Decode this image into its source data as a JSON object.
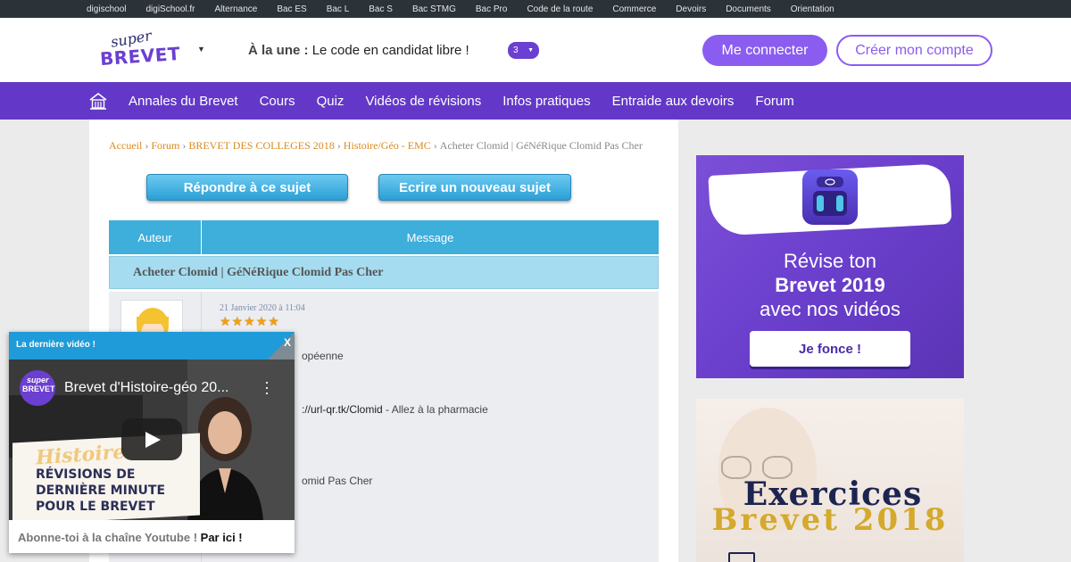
{
  "topbar": {
    "links": [
      "digischool",
      "digiSchool.fr",
      "Alternance",
      "Bac ES",
      "Bac L",
      "Bac S",
      "Bac STMG",
      "Bac Pro",
      "Code de la route",
      "Commerce",
      "Devoirs",
      "Documents",
      "Orientation"
    ]
  },
  "header": {
    "logo_top": "super",
    "logo_bottom": "BREVET",
    "une_label": "À la une :",
    "une_text": "Le code en candidat libre !",
    "une_count": "3",
    "login_label": "Me connecter",
    "signup_label": "Créer mon compte"
  },
  "nav": {
    "items": [
      "Annales du Brevet",
      "Cours",
      "Quiz",
      "Vidéos de révisions",
      "Infos pratiques",
      "Entraide aux devoirs",
      "Forum"
    ]
  },
  "breadcrumb": {
    "items": [
      "Accueil",
      "Forum",
      "BREVET DES COLLEGES 2018",
      "Histoire/Géo - EMC"
    ],
    "current": "Acheter Clomid | GéNéRique Clomid Pas Cher",
    "separator": "›"
  },
  "forum": {
    "reply_label": "Répondre à ce sujet",
    "new_topic_label": "Ecrire un nouveau sujet",
    "col_author": "Auteur",
    "col_message": "Message",
    "subject": "Acheter Clomid | GéNéRique Clomid Pas Cher",
    "post": {
      "date": "21 Janvier 2020 à 11:04",
      "rating": 5,
      "line1": "opéenne",
      "line2_link": "://url-qr.tk/Clomid",
      "line2_text": " - Allez à la pharmacie",
      "line3": "omid Pas Cher"
    }
  },
  "ads": {
    "ad1": {
      "line1": "Révise ton",
      "line2": "Brevet 2019",
      "line3": "avec nos vidéos",
      "cta": "Je fonce !"
    },
    "ad2": {
      "line1": "Exercices",
      "line2": "Brevet 2018"
    }
  },
  "video_widget": {
    "header": "La dernière vidéo !",
    "close": "X",
    "channel_top": "super",
    "channel_bottom": "BREVET",
    "video_title": "Brevet d'Histoire-géo 20...",
    "board_title": "Histoire",
    "board_lines": [
      "RÉVISIONS DE",
      "DERNIÈRE MINUTE",
      "POUR LE BREVET"
    ],
    "footer_text": "Abonne-toi à la chaîne Youtube !",
    "footer_link": "Par ici !"
  }
}
